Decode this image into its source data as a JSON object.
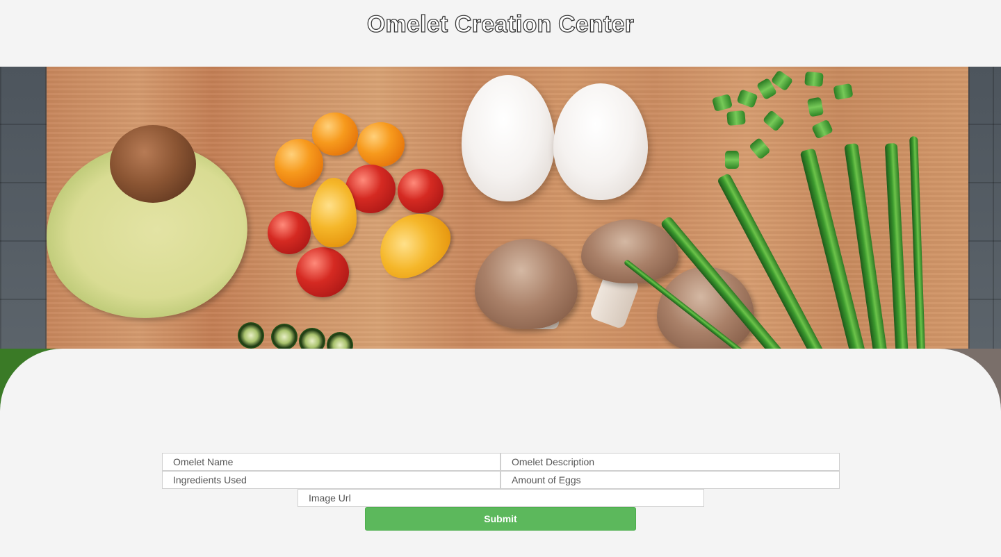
{
  "header": {
    "title": "Omelet Creation Center"
  },
  "hero": {
    "image_description_icon": "food-ingredients-photo"
  },
  "form": {
    "omelet_name_placeholder": "Omelet Name",
    "omelet_description_placeholder": "Omelet Description",
    "ingredients_placeholder": "Ingredients Used",
    "eggs_placeholder": "Amount of Eggs",
    "image_url_placeholder": "Image Url",
    "submit_label": "Submit"
  },
  "colors": {
    "background": "#f4f4f4",
    "submit_button": "#5cb85c",
    "field_border": "#cfcfcf"
  }
}
